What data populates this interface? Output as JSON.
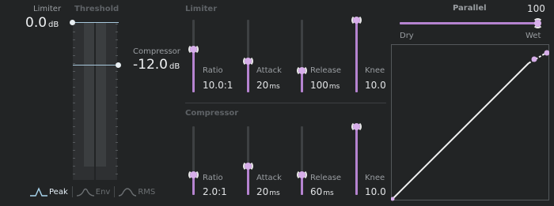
{
  "left": {
    "limiter_label": "Limiter",
    "limiter_value": "0.0",
    "limiter_unit": "dB",
    "threshold_label": "Threshold",
    "compressor_label": "Compressor",
    "compressor_value": "-12.0",
    "compressor_unit": "dB",
    "modes": [
      {
        "label": "Peak",
        "active": true
      },
      {
        "label": "Env",
        "active": false
      },
      {
        "label": "RMS",
        "active": false
      }
    ]
  },
  "limiter": {
    "title": "Limiter",
    "params": [
      {
        "label": "Ratio",
        "value": "10.0:1",
        "unit": "",
        "level": 0.6
      },
      {
        "label": "Attack",
        "value": "20",
        "unit": "ms",
        "level": 0.43
      },
      {
        "label": "Release",
        "value": "100",
        "unit": "ms",
        "level": 0.3
      },
      {
        "label": "Knee",
        "value": "10.0",
        "unit": "",
        "level": 1.0
      }
    ]
  },
  "compressor": {
    "title": "Compressor",
    "params": [
      {
        "label": "Ratio",
        "value": "2.0:1",
        "unit": "",
        "level": 0.3
      },
      {
        "label": "Attack",
        "value": "20",
        "unit": "ms",
        "level": 0.43
      },
      {
        "label": "Release",
        "value": "60",
        "unit": "ms",
        "level": 0.3
      },
      {
        "label": "Knee",
        "value": "10.0",
        "unit": "",
        "level": 1.0
      }
    ]
  },
  "parallel": {
    "title": "Parallel",
    "value": "100",
    "dry_label": "Dry",
    "wet_label": "Wet",
    "level": 1.0
  },
  "colors": {
    "accent": "#b583d0",
    "background": "#222425"
  }
}
